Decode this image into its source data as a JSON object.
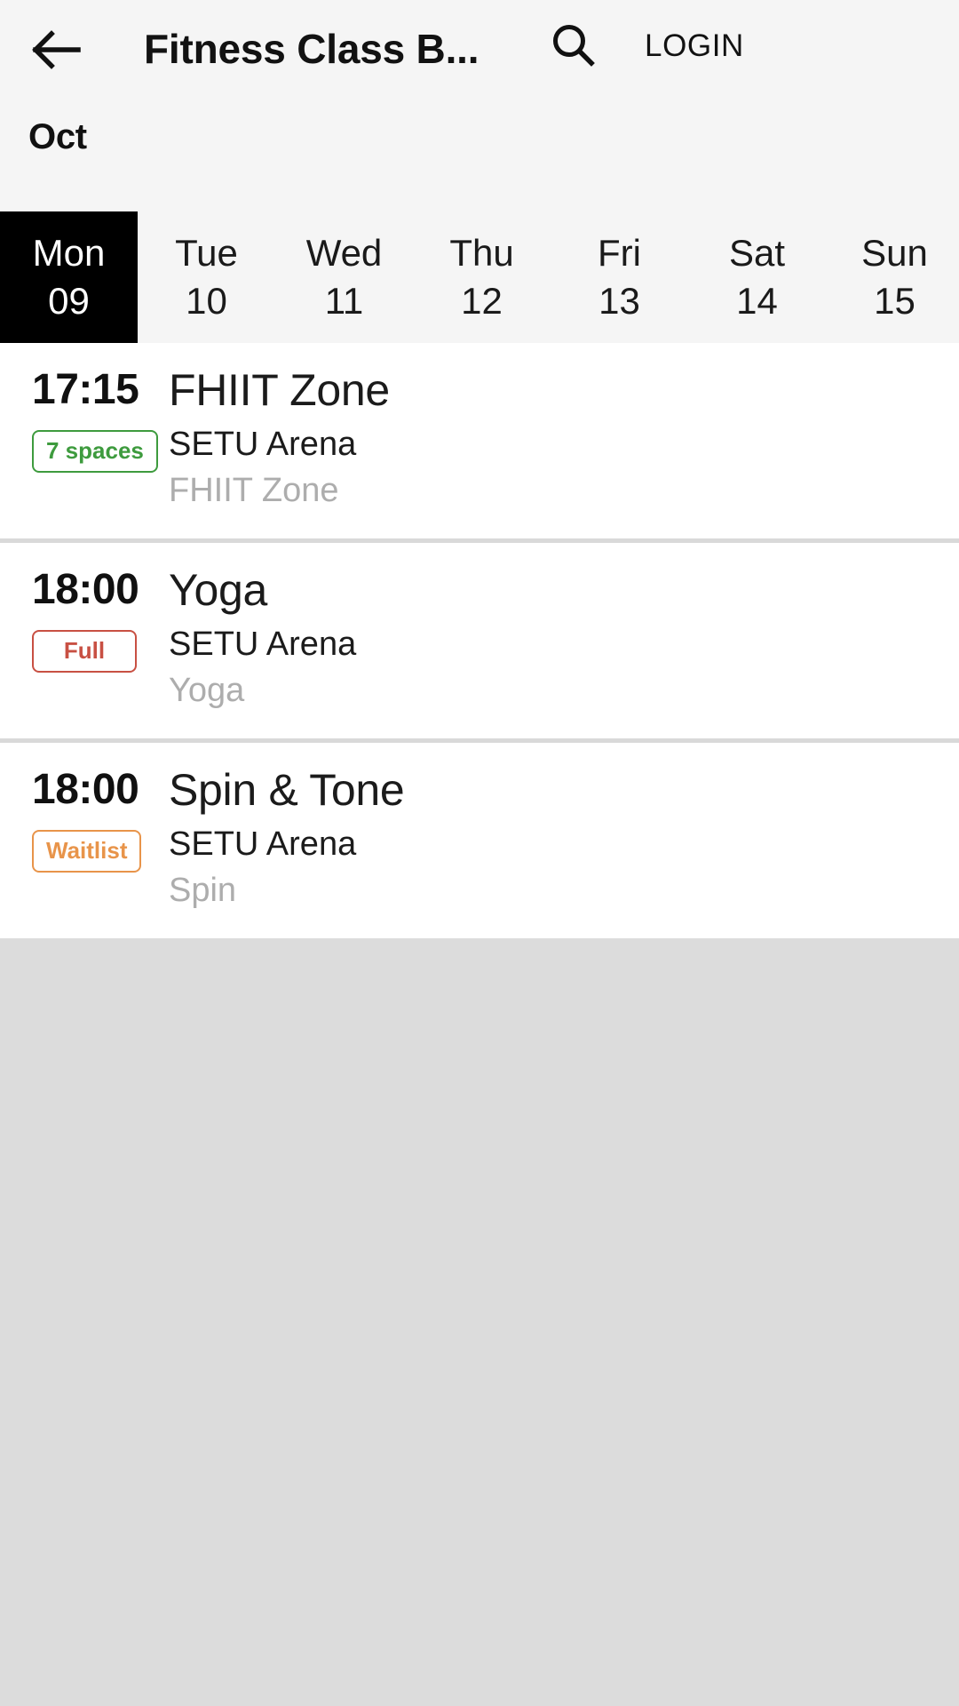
{
  "appbar": {
    "back_icon": "arrow-left-icon",
    "title": "Fitness Class B...",
    "search_icon": "search-icon",
    "login_label": "LOGIN"
  },
  "datestrip": {
    "month": "Oct",
    "days": [
      {
        "dow": "Mon",
        "dom": "09",
        "selected": true
      },
      {
        "dow": "Tue",
        "dom": "10",
        "selected": false
      },
      {
        "dow": "Wed",
        "dom": "11",
        "selected": false
      },
      {
        "dow": "Thu",
        "dom": "12",
        "selected": false
      },
      {
        "dow": "Fri",
        "dom": "13",
        "selected": false
      },
      {
        "dow": "Sat",
        "dom": "14",
        "selected": false
      },
      {
        "dow": "Sun",
        "dom": "15",
        "selected": false
      }
    ]
  },
  "classes": [
    {
      "time": "17:15",
      "badge_label": "7 spaces",
      "badge_type": "spaces",
      "badge_color": "#3e9b3e",
      "name": "FHIIT Zone",
      "venue": "SETU Arena",
      "category": "FHIIT Zone"
    },
    {
      "time": "18:00",
      "badge_label": "Full",
      "badge_type": "full",
      "badge_color": "#c85043",
      "name": "Yoga",
      "venue": "SETU Arena",
      "category": "Yoga"
    },
    {
      "time": "18:00",
      "badge_label": "Waitlist",
      "badge_type": "waitlist",
      "badge_color": "#e8944a",
      "name": "Spin & Tone",
      "venue": "SETU Arena",
      "category": "Spin"
    }
  ],
  "theme": {
    "appbar_bg": "#f5f5f5",
    "selected_day_bg": "#000000",
    "page_bg": "#dcdcdc",
    "card_bg": "#ffffff",
    "divider": "#d9d9d9"
  }
}
